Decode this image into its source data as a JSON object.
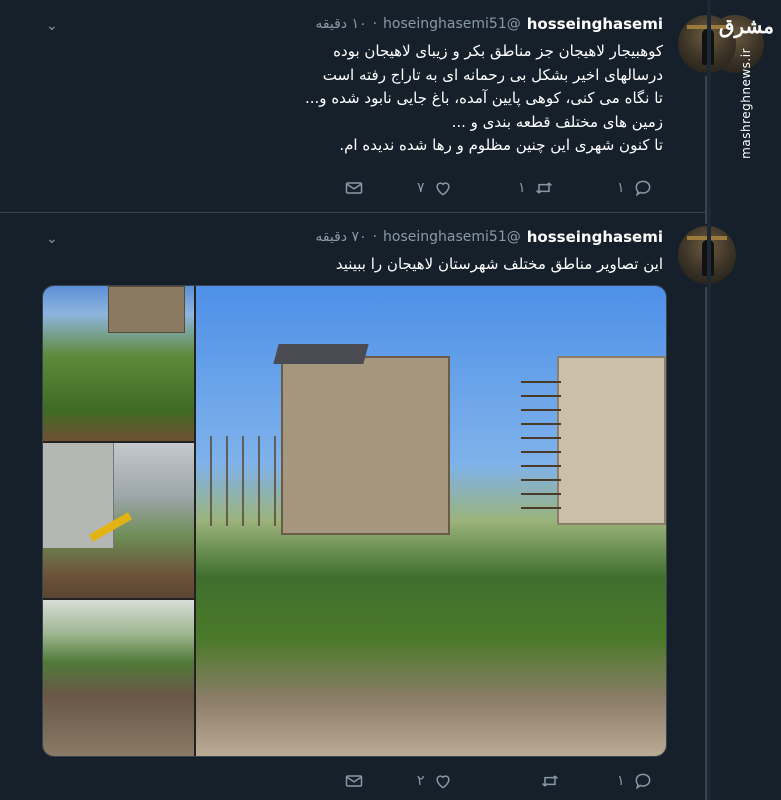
{
  "tweets": [
    {
      "name": "hosseinghasemi",
      "handle": "@hoseinghasemi51",
      "time": "۱۰ دقیقه",
      "lines": [
        "کوهبیجار لاهیجان جز مناطق بکر و زیبای لاهیجان بوده",
        "درسالهای اخیر بشکل بی رحمانه ای به تاراج رفته است",
        "تا نگاه می کنی، کوهی پایین آمده، باغ جایی نابود شده و...",
        "زمین های مختلف قطعه بندی و ...",
        "تا کنون شهری این چنین مظلوم و رها شده ندیده ام."
      ],
      "reply_count": "۱",
      "retweet_count": "۱",
      "like_count": "۷"
    },
    {
      "name": "hosseinghasemi",
      "handle": "@hoseinghasemi51",
      "time": "۷۰ دقیقه",
      "text": "این تصاویر مناطق مختلف شهرستان لاهیجان را ببینید",
      "reply_count": "۱",
      "retweet_count": "",
      "like_count": "۲"
    }
  ],
  "watermark": {
    "logo": "مشرق",
    "url": "mashreghnews.ir"
  },
  "icons": [
    "chevron-down-icon",
    "reply-icon",
    "retweet-icon",
    "like-icon",
    "mail-icon"
  ],
  "colors": {
    "background": "#15202b",
    "muted": "#8899a6",
    "divider": "#38444d"
  }
}
